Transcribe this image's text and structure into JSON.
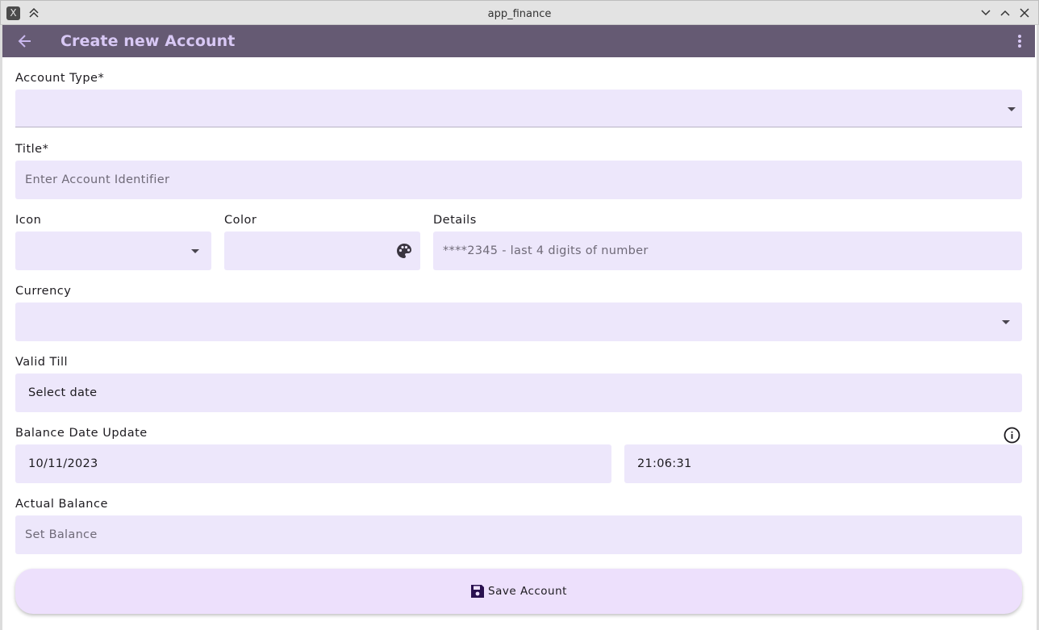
{
  "window": {
    "title": "app_finance",
    "app_icon_glyph": "X"
  },
  "appbar": {
    "title": "Create new Account",
    "background": "#655a73",
    "title_color": "#d8c8f5"
  },
  "form": {
    "account_type": {
      "label": "Account Type*",
      "value": ""
    },
    "title": {
      "label": "Title*",
      "placeholder": "Enter Account Identifier"
    },
    "icon": {
      "label": "Icon",
      "value": ""
    },
    "color": {
      "label": "Color",
      "value": ""
    },
    "details": {
      "label": "Details",
      "placeholder": "****2345 - last 4 digits of number"
    },
    "currency": {
      "label": "Currency",
      "value": ""
    },
    "valid_till": {
      "label": "Valid Till",
      "value": "Select date"
    },
    "balance_date_update": {
      "label": "Balance Date Update",
      "date": "10/11/2023",
      "time": "21:06:31"
    },
    "actual_balance": {
      "label": "Actual Balance",
      "placeholder": "Set Balance"
    }
  },
  "save_button": {
    "label": "Save Account"
  },
  "colors": {
    "field_bg": "#ede7fb",
    "button_bg": "#ede0fc",
    "icon_dark": "#3b1d5c"
  }
}
